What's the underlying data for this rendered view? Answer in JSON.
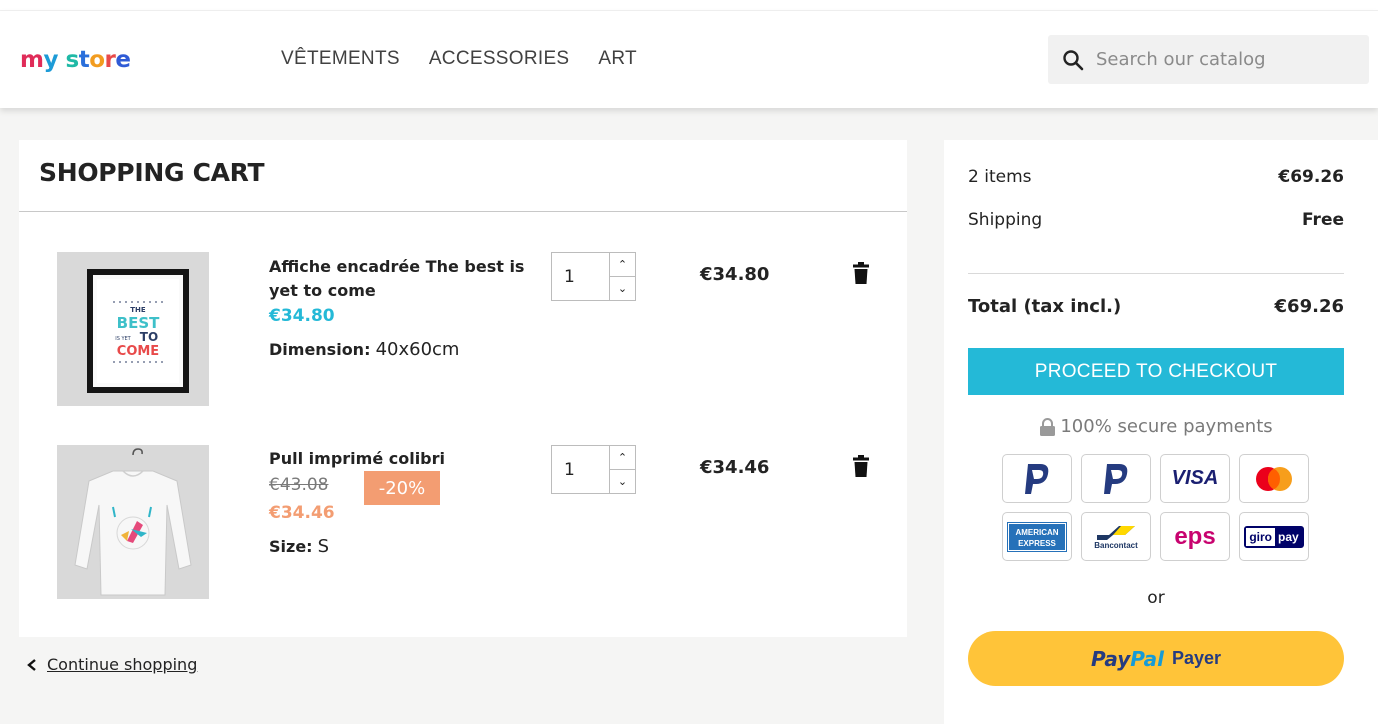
{
  "header": {
    "logo": {
      "letters": [
        "m",
        "y",
        " ",
        "s",
        "t",
        "o",
        "r",
        "e"
      ],
      "colors": [
        "#e02c59",
        "#1d9bd7",
        "#fff",
        "#1fb9a6",
        "#2a6fdb",
        "#f29c1f",
        "#e84a4a",
        "#2f5bd6"
      ]
    },
    "nav": [
      "VÊTEMENTS",
      "ACCESSORIES",
      "ART"
    ],
    "search": {
      "placeholder": "Search our catalog",
      "icon": "search-icon"
    }
  },
  "cart": {
    "title": "SHOPPING CART",
    "items": [
      {
        "name": "Affiche encadrée The best is yet to come",
        "name_line1": "Affiche encadrée The best is",
        "name_line2": "yet to come",
        "price": "€34.80",
        "price_color": "#24b9d7",
        "attr_label": "Dimension",
        "attr_value": "40x60cm",
        "quantity": "1",
        "total": "€34.80",
        "thumb_text": [
          "THE",
          "BEST",
          "IS YET",
          "TO",
          "COME"
        ]
      },
      {
        "name": "Pull imprimé colibri",
        "old_price": "€43.08",
        "discount": "-20%",
        "price": "€34.46",
        "price_color": "#f39d72",
        "attr_label": "Size",
        "attr_value": "S",
        "quantity": "1",
        "total": "€34.46"
      }
    ],
    "continue_label": "Continue shopping"
  },
  "summary": {
    "items_label": "2 items",
    "items_value": "€69.26",
    "shipping_label": "Shipping",
    "shipping_value": "Free",
    "total_label": "Total (tax incl.)",
    "total_value": "€69.26",
    "checkout_label": "PROCEED TO CHECKOUT",
    "secure_label": "100% secure payments",
    "payment_methods": [
      "paypal-icon",
      "paypal-icon",
      "visa-icon",
      "mastercard-icon",
      "american-express-icon",
      "bancontact-icon",
      "eps-icon",
      "giropay-icon"
    ],
    "visa_text": "VISA",
    "amex_text": [
      "AMERICAN",
      "EXPRESS"
    ],
    "bancontact_text": "Bancontact",
    "eps_text": "eps",
    "giro_text": [
      "giro",
      "pay"
    ],
    "or_label": "or",
    "paypal_button": {
      "pay": "Pay",
      "pal": "Pal",
      "payer": "Payer"
    }
  },
  "colors": {
    "accent": "#24b9d7",
    "discount": "#f39d72",
    "paypal_yellow": "#ffc439"
  }
}
